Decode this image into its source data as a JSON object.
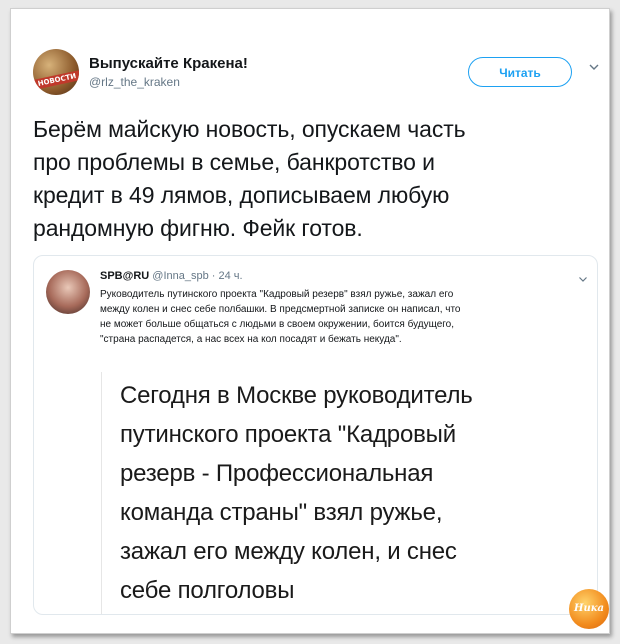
{
  "header": {
    "display_name": "Выпускайте Кракена!",
    "handle": "@rlz_the_kraken",
    "follow_label": "Читать",
    "avatar_text": "НОВОСТИ"
  },
  "tweet": {
    "lines": [
      "Берём майскую новость, опускаем часть",
      "про проблемы в семье, банкротство и",
      "кредит в 49 лямов, дописываем любую",
      "рандомную фигню. Фейк готов."
    ]
  },
  "quote": {
    "name": "SPB@RU",
    "handle": "@Inna_spb",
    "time": "· 24 ч.",
    "text_lines": [
      "Руководитель путинского проекта \"Кадровый резерв\" взял ружье, зажал его",
      "между колен и снес себе полбашки.  В предсмертной записке он написал, что",
      "не может больше общаться с людьми в своем окружении, боится будущего,",
      "\"страна распадется, а нас всех на кол посадят и бежать некуда\"."
    ],
    "image_lines": [
      "Сегодня в Москве руководитель",
      "путинского проекта \"Кадровый",
      "резерв - Профессиональная",
      "команда страны\" взял ружье,",
      "зажал его между колен, и снес",
      "себе полголовы"
    ]
  },
  "watermark": {
    "text": "Ника"
  },
  "colors": {
    "accent": "#1da1f2",
    "text": "#14171a",
    "muted": "#657786",
    "border": "#e1e8ed"
  }
}
